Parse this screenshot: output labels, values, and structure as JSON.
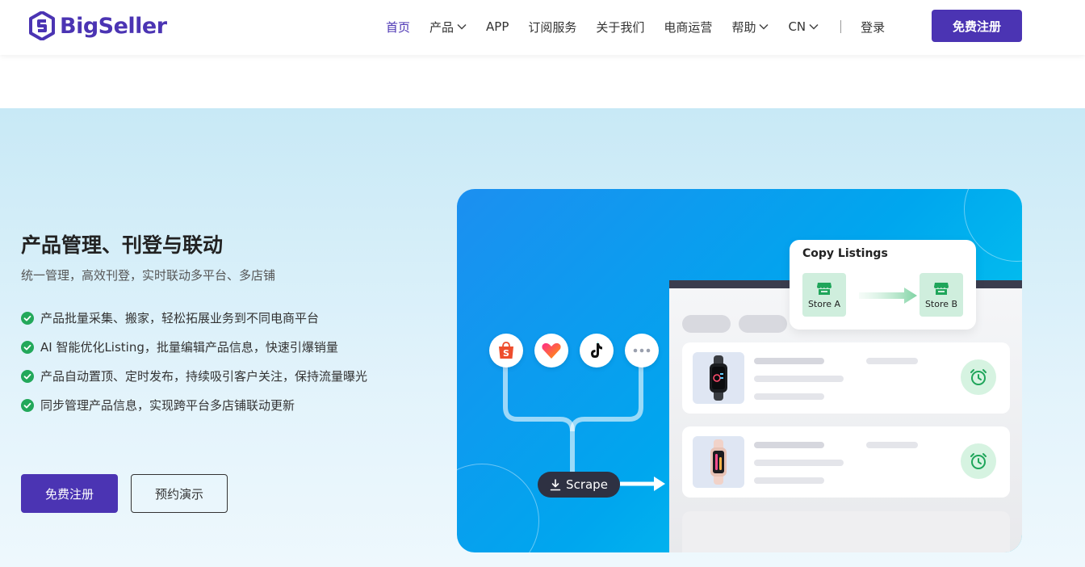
{
  "header": {
    "logo_text": "BigSeller",
    "nav": [
      {
        "label": "首页",
        "active": true,
        "dropdown": false
      },
      {
        "label": "产品",
        "active": false,
        "dropdown": true
      },
      {
        "label": "APP",
        "active": false,
        "dropdown": false
      },
      {
        "label": "订阅服务",
        "active": false,
        "dropdown": false
      },
      {
        "label": "关于我们",
        "active": false,
        "dropdown": false
      },
      {
        "label": "电商运营",
        "active": false,
        "dropdown": false
      },
      {
        "label": "帮助",
        "active": false,
        "dropdown": true
      },
      {
        "label": "CN",
        "active": false,
        "dropdown": true
      }
    ],
    "login_label": "登录",
    "signup_label": "免费注册"
  },
  "hero": {
    "title": "产品管理、刊登与联动",
    "subtitle": "统一管理，高效刊登，实时联动多平台、多店铺",
    "features": [
      "产品批量采集、搬家，轻松拓展业务到不同电商平台",
      "AI 智能优化Listing，批量编辑产品信息，快速引爆销量",
      "产品自动置顶、定时发布，持续吸引客户关注，保持流量曝光",
      "同步管理产品信息，实现跨平台多店铺联动更新"
    ],
    "primary_button": "免费注册",
    "secondary_button": "预约演示"
  },
  "illustration": {
    "copy_listings_title": "Copy Listings",
    "store_a": "Store A",
    "store_b": "Store B",
    "scrape_label": "Scrape",
    "platforms": [
      "shopee-icon",
      "lazada-icon",
      "tiktok-icon",
      "more-icon"
    ]
  },
  "colors": {
    "brand": "#4b34b3",
    "check": "#23a85a",
    "alarm": "#1fa55a"
  }
}
